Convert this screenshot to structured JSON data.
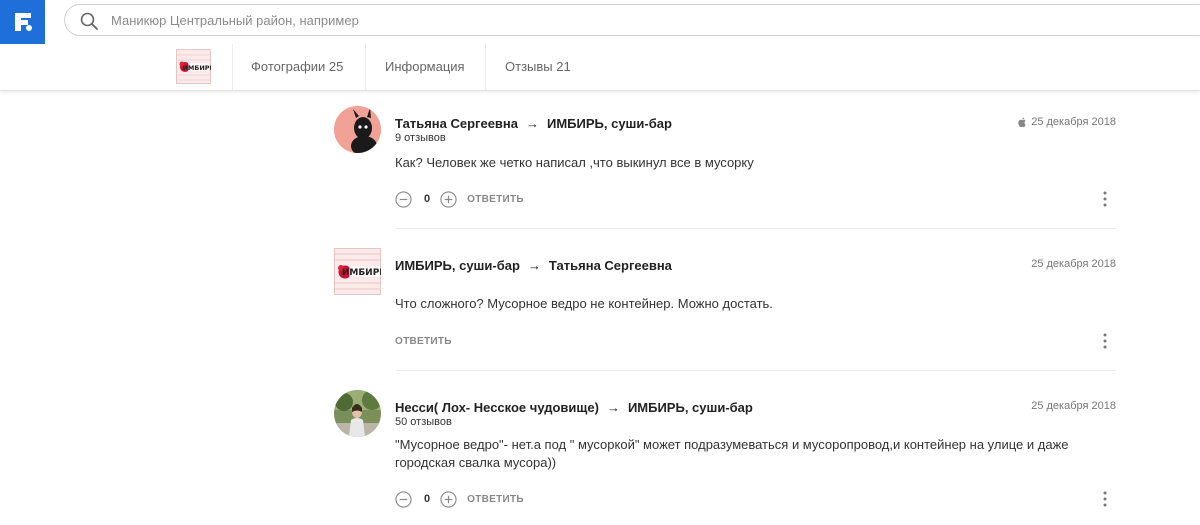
{
  "search": {
    "placeholder": "Маникюр Центральный район, например"
  },
  "tabs": [
    {
      "label": "Фотографии 25"
    },
    {
      "label": "Информация"
    },
    {
      "label": "Отзывы 21"
    }
  ],
  "business_logo_text": "ИМБИРЬ",
  "reviews": [
    {
      "author": "Татьяна Сергеевна",
      "target": "ИМБИРЬ, суши-бар",
      "count": "9 отзывов",
      "date": "25 декабря 2018",
      "text": "Как? Человек же четко написал ,что выкинул все в мусорку",
      "votes": "0",
      "reply_label": "ОТВЕТИТЬ"
    },
    {
      "author": "ИМБИРЬ, суши-бар",
      "target": "Татьяна Сергеевна",
      "count": "",
      "date": "25 декабря 2018",
      "text": "Что сложного? Мусорное ведро не контейнер. Можно достать.",
      "votes": "",
      "reply_label": "ОТВЕТИТЬ"
    },
    {
      "author": "Несси( Лох- Несское чудовище)",
      "target": "ИМБИРЬ, суши-бар",
      "count": "50 отзывов",
      "date": "25 декабря 2018",
      "text": "\"Мусорное ведро\"- нет.а под \" мусоркой\" может подразумеваться и мусоропровод,и контейнер на улице и даже городская свалка мусора))",
      "votes": "0",
      "reply_label": "ОТВЕТИТЬ"
    }
  ],
  "icons": {
    "logo": "flamp-logo-icon",
    "search": "search-icon",
    "apple": "apple-icon",
    "minus": "minus-circle-icon",
    "plus": "plus-circle-icon",
    "more": "kebab-menu-icon"
  },
  "colors": {
    "brand": "#1e6fd9",
    "logo_red": "#c8102e"
  }
}
